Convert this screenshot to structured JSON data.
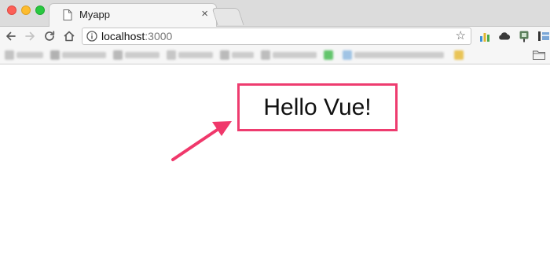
{
  "window": {
    "tab": {
      "title": "Myapp",
      "close": "×",
      "icon": "page-icon"
    },
    "controls": [
      "close",
      "minimize",
      "zoom"
    ]
  },
  "toolbar": {
    "url_host": "localhost",
    "url_port": ":3000",
    "icons": [
      "back-icon",
      "forward-icon",
      "reload-icon",
      "home-icon",
      "info-icon",
      "star-icon"
    ],
    "star": "☆"
  },
  "bookmarks": {
    "folder_icon": "folder-icon"
  },
  "content": {
    "heading": "Hello Vue!",
    "box_color": "#ee3c6f",
    "arrow_color": "#f0386b"
  }
}
